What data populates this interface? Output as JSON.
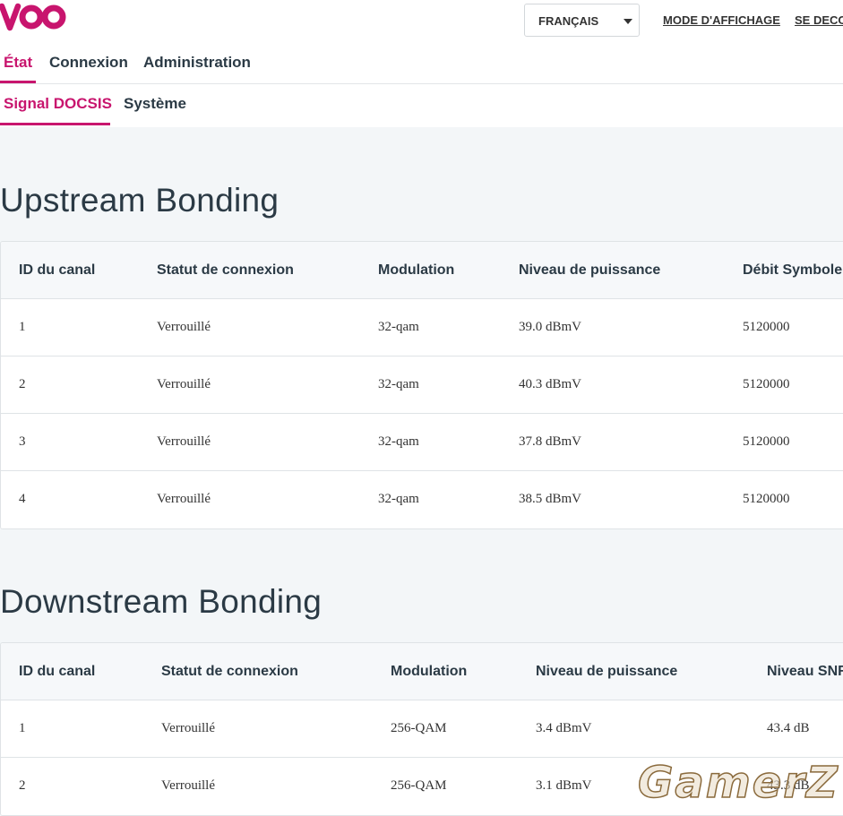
{
  "brand": {
    "logo_text": "voo",
    "accent": "#c8156e"
  },
  "header": {
    "language_selected": "FRANÇAIS",
    "display_mode_link": "MODE D'AFFICHAGE",
    "logout_link": "SE DECO"
  },
  "nav": {
    "primary": [
      "État",
      "Connexion",
      "Administration"
    ],
    "secondary": [
      "Signal DOCSIS",
      "Système"
    ]
  },
  "upstream": {
    "title": "Upstream Bonding",
    "columns": [
      "ID du canal",
      "Statut de connexion",
      "Modulation",
      "Niveau de puissance",
      "Débit Symbole"
    ],
    "rows": [
      [
        "1",
        "Verrouillé",
        "32-qam",
        "39.0 dBmV",
        "5120000"
      ],
      [
        "2",
        "Verrouillé",
        "32-qam",
        "40.3 dBmV",
        "5120000"
      ],
      [
        "3",
        "Verrouillé",
        "32-qam",
        "37.8 dBmV",
        "5120000"
      ],
      [
        "4",
        "Verrouillé",
        "32-qam",
        "38.5 dBmV",
        "5120000"
      ]
    ]
  },
  "downstream": {
    "title": "Downstream Bonding",
    "columns": [
      "ID du canal",
      "Statut de connexion",
      "Modulation",
      "Niveau de puissance",
      "Niveau SNR"
    ],
    "rows": [
      [
        "1",
        "Verrouillé",
        "256-QAM",
        "3.4 dBmV",
        "43.4 dB"
      ],
      [
        "2",
        "Verrouillé",
        "256-QAM",
        "3.1 dBmV",
        "43.3 dB"
      ]
    ]
  },
  "watermark": "GamerZ"
}
